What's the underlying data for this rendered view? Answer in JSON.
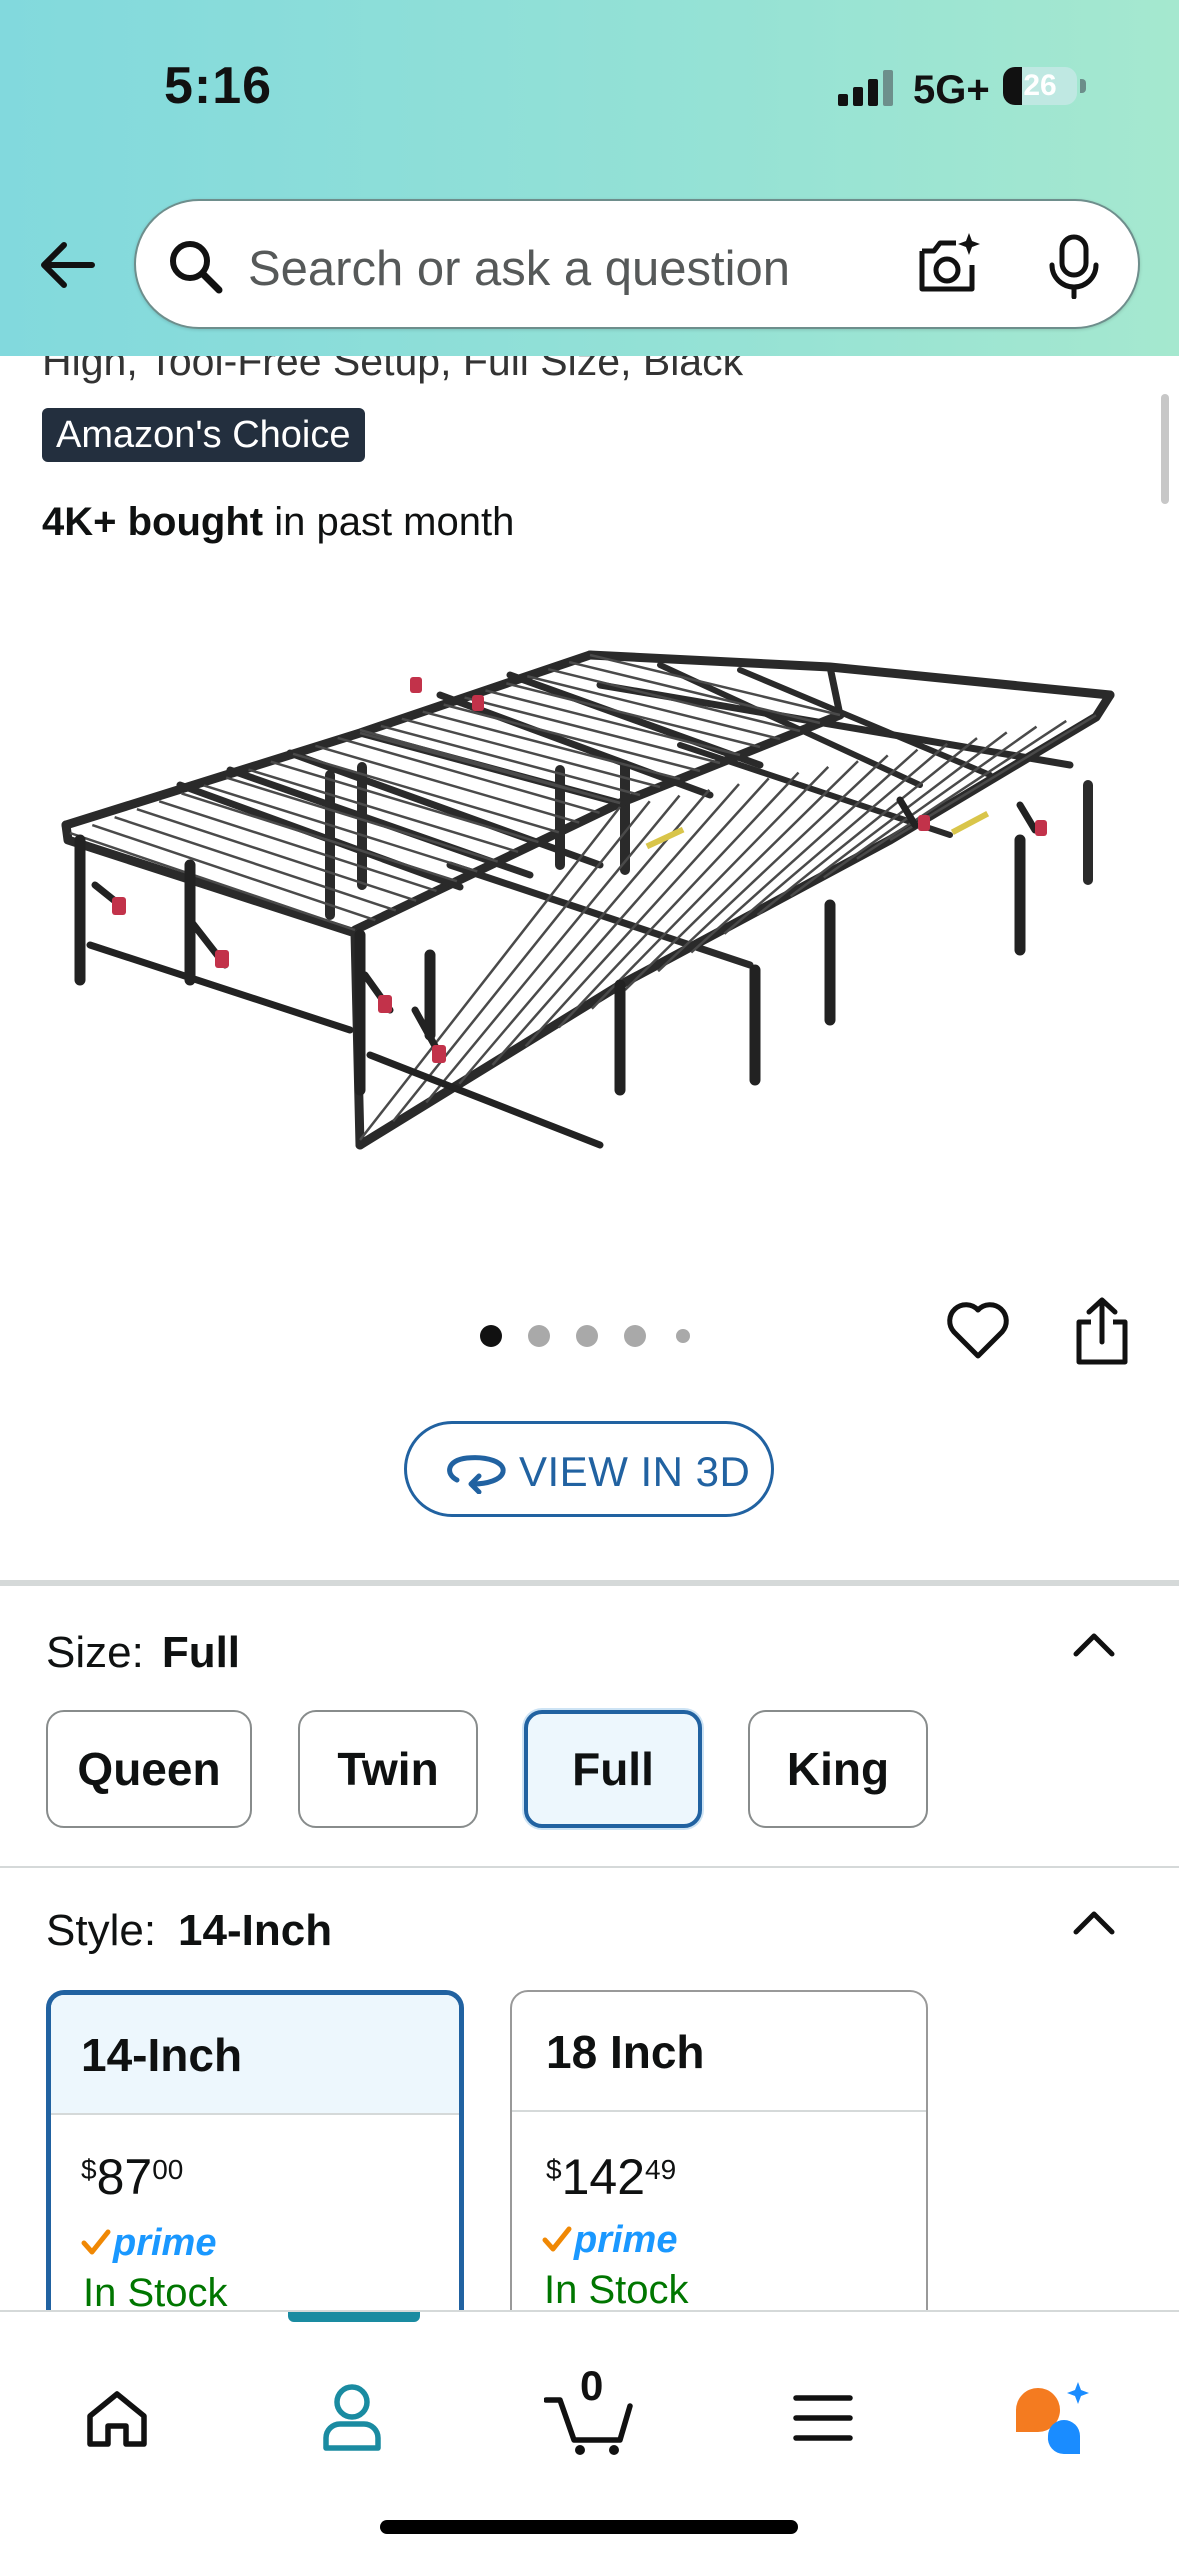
{
  "status_bar": {
    "time": "5:16",
    "network": "5G+",
    "battery_percent": "26",
    "battery_level": 0.26
  },
  "search": {
    "placeholder": "Search or ask a question"
  },
  "product": {
    "title_fragment": "High, Tool-Free Setup, Full Size, Black",
    "badge": "Amazon's Choice",
    "bought_bold": "4K+ bought",
    "bought_rest": " in past month",
    "image_count": 5,
    "current_image": 1
  },
  "view3d": {
    "label": "VIEW IN 3D"
  },
  "size": {
    "label": "Size:",
    "selected": "Full",
    "options": [
      "Queen",
      "Twin",
      "Full",
      "King"
    ]
  },
  "style": {
    "label": "Style:",
    "selected": "14-Inch",
    "options": [
      {
        "name": "14-Inch",
        "price_symbol": "$",
        "price_whole": "87",
        "price_fraction": "00",
        "prime": "prime",
        "availability": "In Stock"
      },
      {
        "name": "18 Inch",
        "price_symbol": "$",
        "price_whole": "142",
        "price_fraction": "49",
        "prime": "prime",
        "availability": "In Stock"
      }
    ]
  },
  "nav": {
    "cart_count": "0",
    "items": [
      "home-icon",
      "account-icon",
      "cart-icon",
      "menu-icon",
      "rufus-assistant-icon"
    ]
  },
  "colors": {
    "accent_blue": "#2162a1",
    "header_teal": "#93e1d6",
    "prime_blue": "#1a98ff",
    "in_stock_green": "#007600",
    "nav_active": "#1a8ba1"
  }
}
